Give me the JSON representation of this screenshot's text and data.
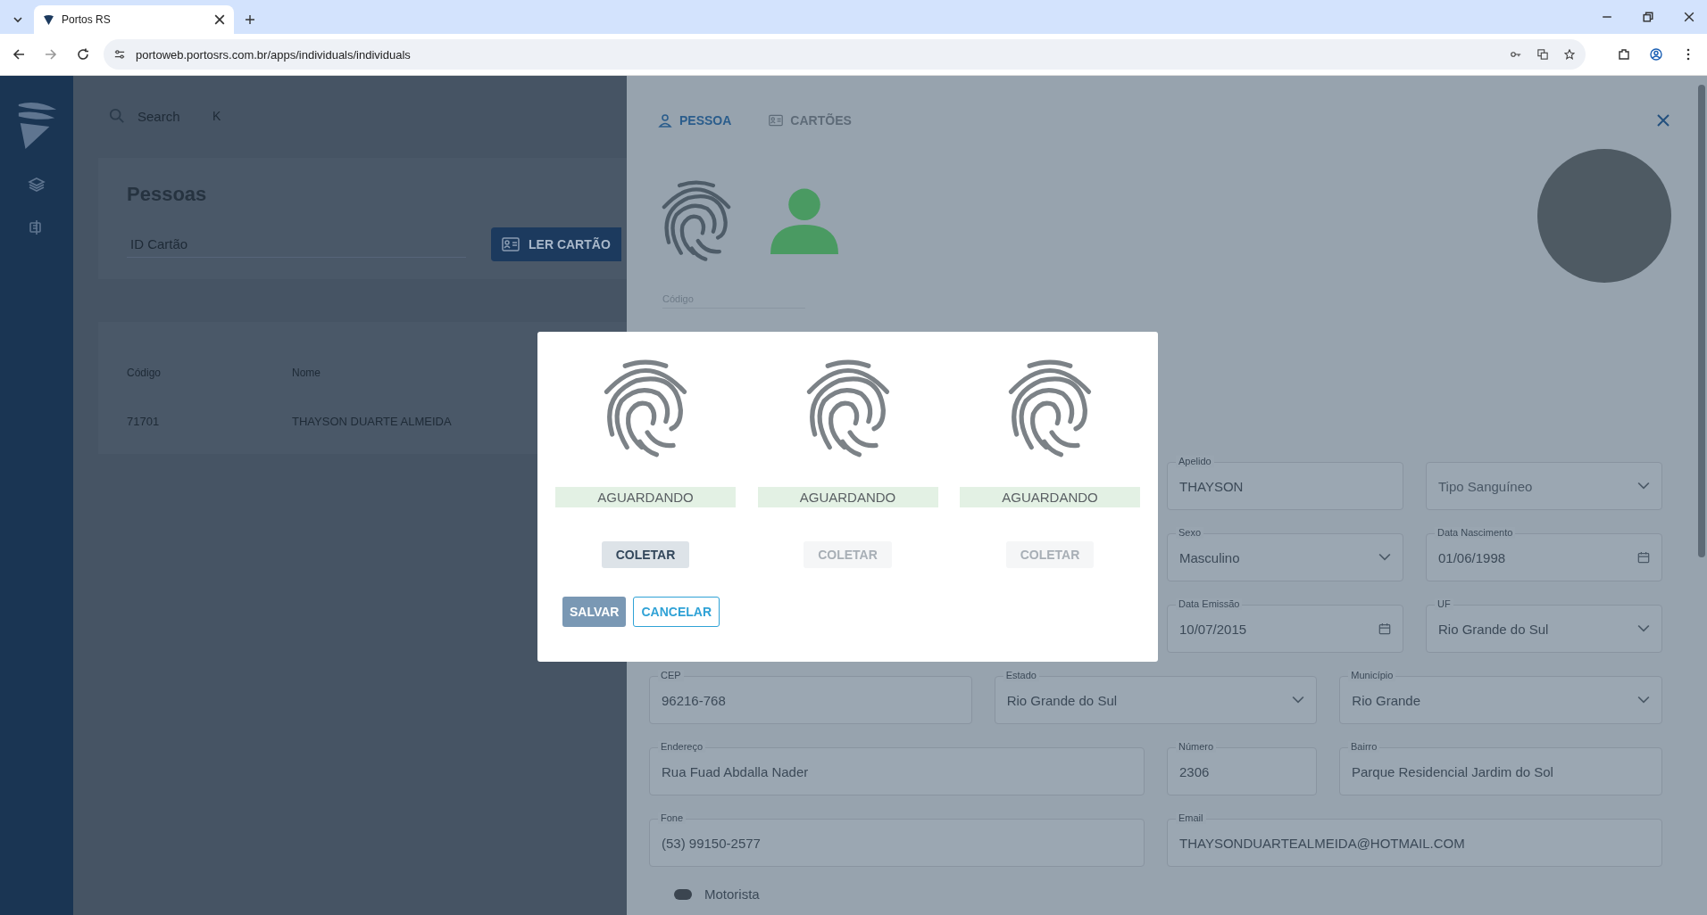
{
  "browser": {
    "tab_title": "Portos RS",
    "url": "portoweb.portosrs.com.br/apps/individuals/individuals"
  },
  "list_page": {
    "search_placeholder": "Search",
    "search_shortcut": "K",
    "title": "Pessoas",
    "card_field_placeholder": "ID Cartão",
    "read_button": "LER CARTÃO",
    "table": {
      "columns": [
        "Código",
        "Nome"
      ],
      "rows": [
        [
          "71701",
          "THAYSON DUARTE ALMEIDA"
        ]
      ]
    }
  },
  "drawer": {
    "tabs": [
      {
        "label": "PESSOA",
        "selected": true
      },
      {
        "label": "CARTÕES",
        "selected": false
      }
    ],
    "code_label": "Código",
    "form_rows": [
      {
        "fields": [
          {
            "kind": "text",
            "label": "Apelido",
            "value": "THAYSON"
          },
          {
            "kind": "select",
            "placeholder": "Tipo Sanguíneo"
          }
        ]
      },
      {
        "fields": [
          {
            "kind": "select",
            "label": "Sexo",
            "value": "Masculino"
          },
          {
            "kind": "date",
            "label": "Data Nascimento",
            "value": "01/06/1998"
          }
        ]
      },
      {
        "fields": [
          {
            "kind": "date",
            "label": "Data Emissão",
            "value": "10/07/2015"
          },
          {
            "kind": "select",
            "label": "UF",
            "value": "Rio Grande do Sul"
          }
        ]
      },
      {
        "fields": [
          {
            "kind": "text",
            "label": "CEP",
            "value": "96216-768"
          },
          {
            "kind": "select",
            "label": "Estado",
            "value": "Rio Grande do Sul"
          },
          {
            "kind": "select",
            "label": "Município",
            "value": "Rio Grande"
          }
        ]
      },
      {
        "fields": [
          {
            "kind": "text",
            "label": "Endereço",
            "value": "Rua Fuad Abdalla Nader"
          },
          {
            "kind": "text",
            "label": "Número",
            "value": "2306"
          },
          {
            "kind": "text",
            "label": "Bairro",
            "value": "Parque Residencial Jardim do Sol"
          }
        ]
      },
      {
        "fields": [
          {
            "kind": "text",
            "label": "Fone",
            "value": "(53) 99150-2577"
          },
          {
            "kind": "text",
            "label": "Email",
            "value": "THAYSONDUARTEALMEIDA@HOTMAIL.COM"
          }
        ]
      }
    ],
    "toggle": {
      "label": "Motorista",
      "on": false
    }
  },
  "dialog": {
    "fingers": [
      {
        "status": "AGUARDANDO",
        "button": "COLETAR",
        "disabled": false
      },
      {
        "status": "AGUARDANDO",
        "button": "COLETAR",
        "disabled": true
      },
      {
        "status": "AGUARDANDO",
        "button": "COLETAR",
        "disabled": true
      }
    ],
    "save": "SALVAR",
    "cancel": "CANCELAR"
  }
}
